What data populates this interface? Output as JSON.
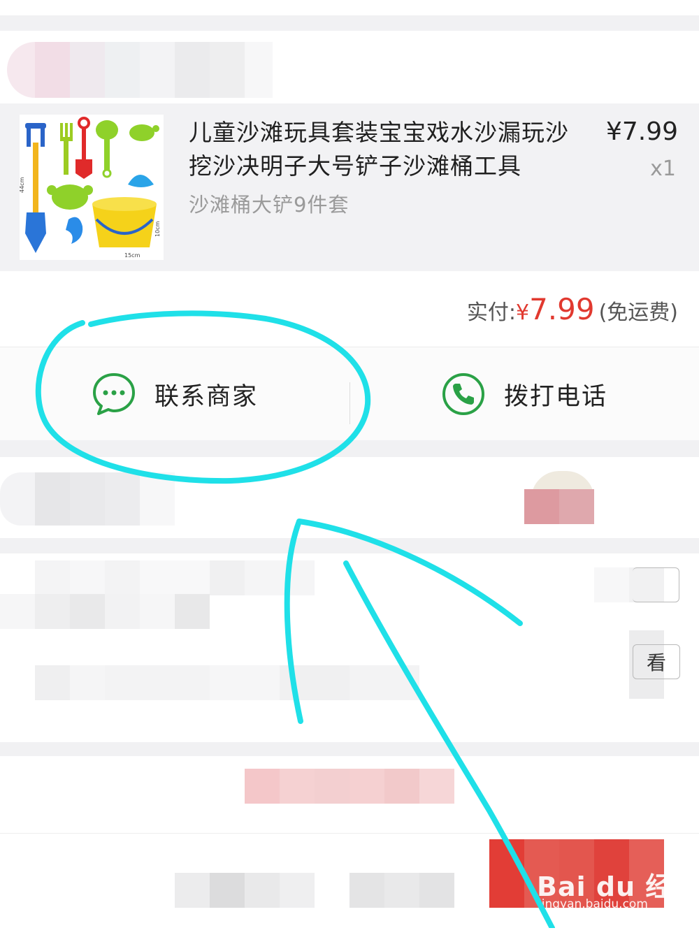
{
  "order": {
    "product": {
      "title": "儿童沙滩玩具套装宝宝戏水沙漏玩沙挖沙决明子大号铲子沙滩桶工具",
      "variant": "沙滩桶大铲9件套",
      "price": "¥7.99",
      "quantity": "x1",
      "image_labels": [
        "44cm",
        "10cm",
        "15cm"
      ]
    },
    "payment": {
      "label": "实付:",
      "currency": "¥",
      "amount": "7.99",
      "shipping_note": "(免运费)"
    },
    "actions": {
      "contact_merchant": "联系商家",
      "call_phone": "拨打电话"
    },
    "obscured_button_text": "看"
  },
  "watermark": {
    "logo": "Bai du 经验",
    "url": "jingyan.baidu.com"
  },
  "colors": {
    "price_red": "#e1392f",
    "icon_green": "#2aa146",
    "annotation_cyan": "#1fe0e8",
    "separator_gray": "#f1f1f3"
  }
}
